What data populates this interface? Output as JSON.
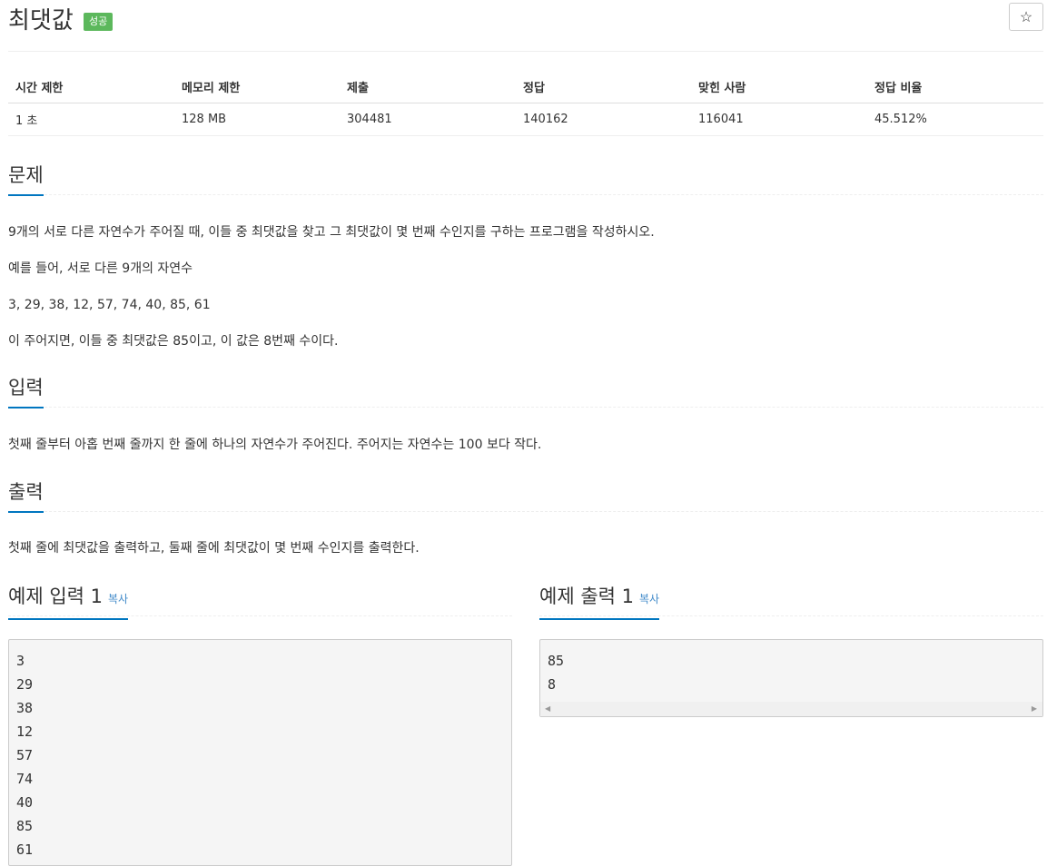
{
  "header": {
    "title": "최댓값",
    "badge": "성공",
    "star_icon": "☆"
  },
  "info_table": {
    "headers": [
      "시간 제한",
      "메모리 제한",
      "제출",
      "정답",
      "맞힌 사람",
      "정답 비율"
    ],
    "values": [
      "1 초",
      "128 MB",
      "304481",
      "140162",
      "116041",
      "45.512%"
    ]
  },
  "problem": {
    "heading": "문제",
    "paragraphs": [
      "9개의 서로 다른 자연수가 주어질 때, 이들 중 최댓값을 찾고 그 최댓값이 몇 번째 수인지를 구하는 프로그램을 작성하시오.",
      "예를 들어, 서로 다른 9개의 자연수",
      "3, 29, 38, 12, 57, 74, 40, 85, 61",
      "이 주어지면, 이들 중 최댓값은 85이고, 이 값은 8번째 수이다."
    ]
  },
  "input": {
    "heading": "입력",
    "text": "첫째 줄부터 아홉 번째 줄까지 한 줄에 하나의 자연수가 주어진다. 주어지는 자연수는 100 보다 작다."
  },
  "output": {
    "heading": "출력",
    "text": "첫째 줄에 최댓값을 출력하고, 둘째 줄에 최댓값이 몇 번째 수인지를 출력한다."
  },
  "sample_input": {
    "heading": "예제 입력 1",
    "copy_label": "복사",
    "content": "3\n29\n38\n12\n57\n74\n40\n85\n61"
  },
  "sample_output": {
    "heading": "예제 출력 1",
    "copy_label": "복사",
    "content": "85\n8"
  },
  "colors": {
    "accent": "#0076c0",
    "badge": "#5cb85c",
    "link": "#428bca"
  }
}
